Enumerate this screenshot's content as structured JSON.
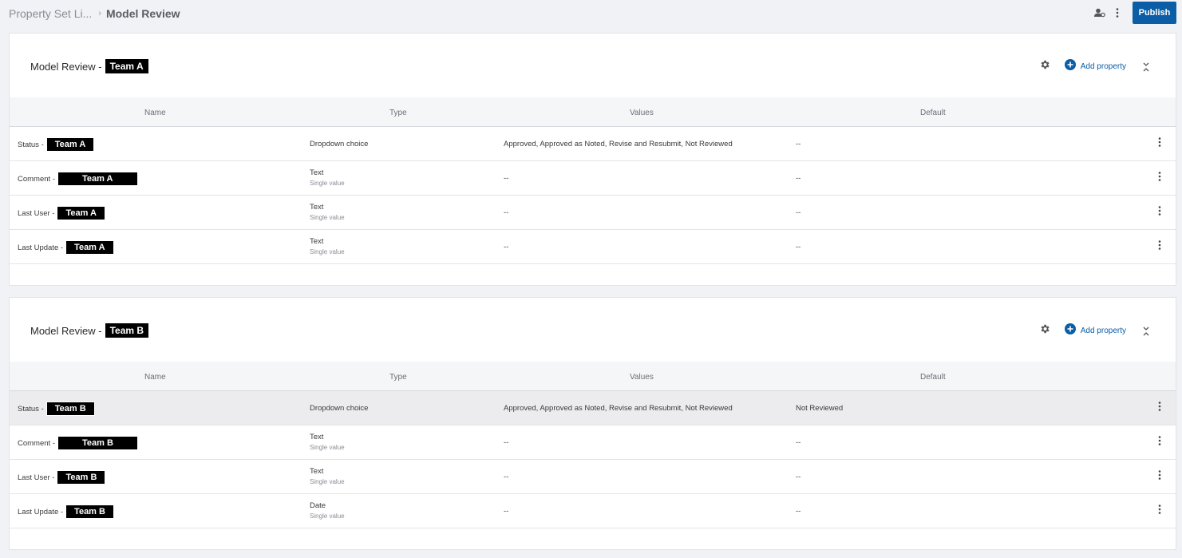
{
  "breadcrumb": {
    "parent": "Property Set Li...",
    "current": "Model Review"
  },
  "toolbar": {
    "publish_label": "Publish"
  },
  "colors": {
    "accent": "#0b5ea6",
    "background": "#f1f2f5"
  },
  "columns": [
    "Name",
    "Type",
    "Values",
    "Default"
  ],
  "sets": [
    {
      "title": "Model Review -",
      "team": "Team A",
      "add_property_label": "Add property",
      "rows": [
        {
          "name": "Status -",
          "team": "Team A",
          "type": "Dropdown choice",
          "type_sub": "",
          "values": "Approved, Approved as Noted, Revise and Resubmit, Not Reviewed",
          "default": "--"
        },
        {
          "name": "Comment -",
          "team": "Team A",
          "type": "Text",
          "type_sub": "Single value",
          "values": "--",
          "default": "--"
        },
        {
          "name": "Last User -",
          "team": "Team A",
          "type": "Text",
          "type_sub": "Single value",
          "values": "--",
          "default": "--"
        },
        {
          "name": "Last Update -",
          "team": "Team A",
          "type": "Text",
          "type_sub": "Single value",
          "values": "--",
          "default": "--"
        }
      ]
    },
    {
      "title": "Model Review -",
      "team": "Team B",
      "add_property_label": "Add property",
      "rows": [
        {
          "name": "Status -",
          "team": "Team B",
          "type": "Dropdown choice",
          "type_sub": "",
          "values": "Approved, Approved as Noted, Revise and Resubmit, Not Reviewed",
          "default": "Not Reviewed"
        },
        {
          "name": "Comment -",
          "team": "Team B",
          "type": "Text",
          "type_sub": "Single value",
          "values": "--",
          "default": "--"
        },
        {
          "name": "Last User -",
          "team": "Team B",
          "type": "Text",
          "type_sub": "Single value",
          "values": "--",
          "default": "--"
        },
        {
          "name": "Last Update -",
          "team": "Team B",
          "type": "Date",
          "type_sub": "Single value",
          "values": "--",
          "default": "--"
        }
      ]
    }
  ]
}
